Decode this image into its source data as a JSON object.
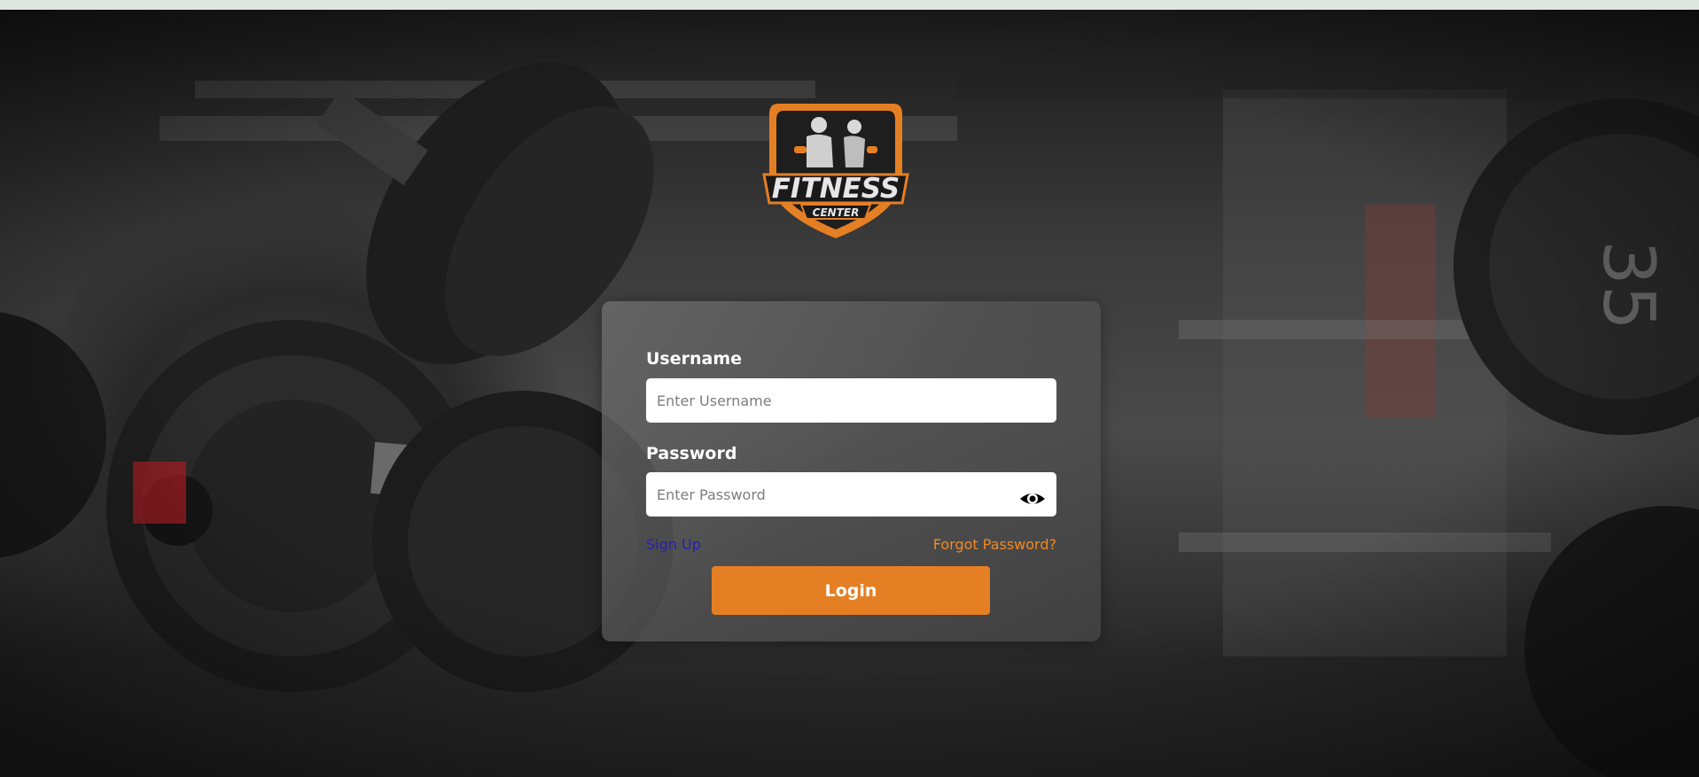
{
  "logo": {
    "title": "FITNESS",
    "subtitle": "CENTER",
    "accent_color": "#e57f24"
  },
  "login_form": {
    "username_label": "Username",
    "username_placeholder": "Enter Username",
    "password_label": "Password",
    "password_placeholder": "Enter Password",
    "show_password_icon": "eye-icon",
    "signup_link": "Sign Up",
    "forgot_link": "Forgot Password?",
    "login_button": "Login"
  },
  "colors": {
    "primary": "#e57f24",
    "signup_link": "#2b1fb0",
    "forgot_link": "#f08a24"
  }
}
